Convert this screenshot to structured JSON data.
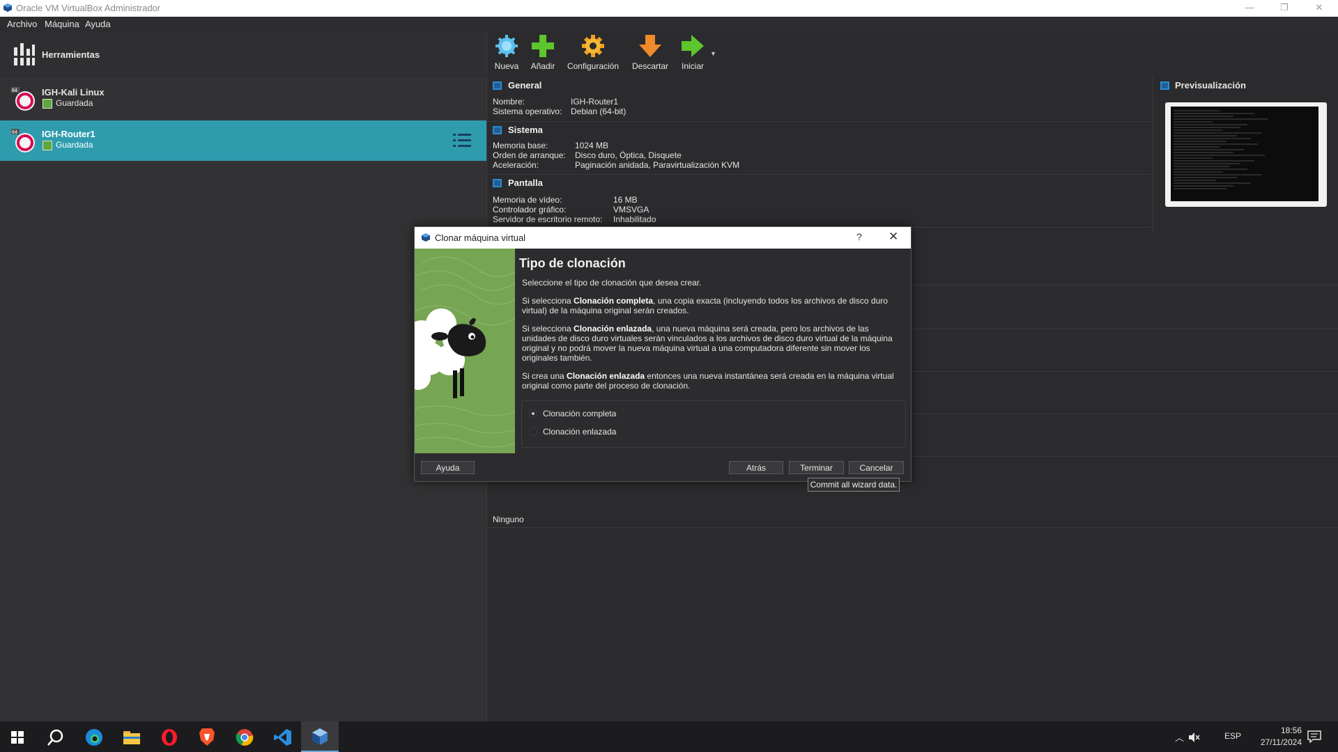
{
  "window": {
    "title": "Oracle VM VirtualBox Administrador"
  },
  "menu": [
    "Archivo",
    "Máquina",
    "Ayuda"
  ],
  "tools": {
    "label": "Herramientas"
  },
  "vms": [
    {
      "name": "IGH-Kali Linux",
      "state": "Guardada"
    },
    {
      "name": "IGH-Router1",
      "state": "Guardada"
    }
  ],
  "toolbar": [
    "Nueva",
    "Añadir",
    "Configuración",
    "Descartar",
    "Iniciar"
  ],
  "details": {
    "general": {
      "title": "General",
      "rows": [
        {
          "k": "Nombre:",
          "v": "IGH-Router1"
        },
        {
          "k": "Sistema operativo:",
          "v": "Debian (64-bit)"
        }
      ]
    },
    "sistema": {
      "title": "Sistema",
      "rows": [
        {
          "k": "Memoria base:",
          "v": "1024 MB"
        },
        {
          "k": "Orden de arranque:",
          "v": "Disco duro, Óptica, Disquete"
        },
        {
          "k": "Aceleración:",
          "v": "Paginación anidada, Paravirtualización KVM"
        }
      ]
    },
    "pantalla": {
      "title": "Pantalla",
      "rows": [
        {
          "k": "Memoria de vídeo:",
          "v": "16 MB"
        },
        {
          "k": "Controlador gráfico:",
          "v": "VMSVGA"
        },
        {
          "k": "Servidor de escritorio remoto:",
          "v": "Inhabilitado"
        }
      ]
    },
    "ninguno": "Ninguno"
  },
  "preview": {
    "title": "Previsualización"
  },
  "dialog": {
    "title": "Clonar máquina virtual",
    "help_glyph": "?",
    "close_glyph": "✕",
    "heading": "Tipo de clonación",
    "p1": "Seleccione el tipo de clonación que desea crear.",
    "p2_pre": "Si selecciona ",
    "p2_b": "Clonación completa",
    "p2_post": ", una copia exacta (incluyendo todos los archivos de disco duro virtual) de la máquina original serán creados.",
    "p3_pre": "Si selecciona ",
    "p3_b": "Clonación enlazada",
    "p3_post": ", una nueva máquina será creada, pero los archivos de las unidades de disco duro virtuales serán vinculados a los archivos de disco duro virtual de la máquina original y no podrá mover la nueva máquina virtual a una computadora diferente sin mover los originales también.",
    "p4_pre": "Si crea una ",
    "p4_b": "Clonación enlazada",
    "p4_post": " entonces una nueva instantánea será creada en la máquina virtual original como parte del proceso de clonación.",
    "options": [
      "Clonación completa",
      "Clonación enlazada"
    ],
    "selected": "Clonación completa",
    "buttons": {
      "help": "Ayuda",
      "back": "Atrás",
      "finish": "Terminar",
      "cancel": "Cancelar"
    },
    "tooltip": "Commit all wizard data."
  },
  "taskbar": {
    "lang": "ESP",
    "time": "18:56",
    "date": "27/11/2024"
  }
}
